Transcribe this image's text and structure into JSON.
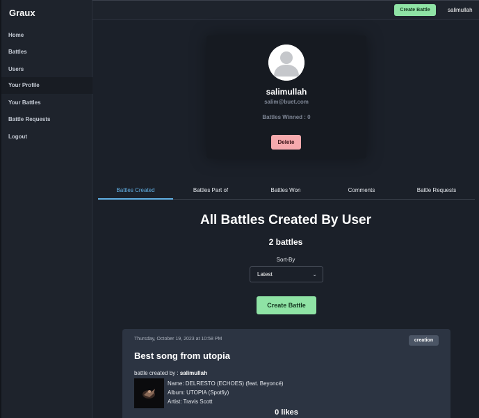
{
  "app": {
    "brand": "Graux"
  },
  "sidebar": {
    "items": [
      {
        "label": "Home"
      },
      {
        "label": "Battles"
      },
      {
        "label": "Users"
      },
      {
        "label": "Your Profile",
        "active": true
      },
      {
        "label": "Your Battles"
      },
      {
        "label": "Battle Requests"
      },
      {
        "label": "Logout"
      }
    ]
  },
  "topbar": {
    "create_label": "Create Battle",
    "username": "salimullah"
  },
  "profile": {
    "name": "salimullah",
    "email": "salim@buet.com",
    "wins": "Battles Winned : 0",
    "delete_label": "Delete"
  },
  "tabs": [
    {
      "label": "Battles Created",
      "active": true
    },
    {
      "label": "Battles Part of"
    },
    {
      "label": "Battles Won"
    },
    {
      "label": "Comments"
    },
    {
      "label": "Battle Requests"
    }
  ],
  "main": {
    "title": "All Battles Created By User",
    "count": "2 battles",
    "sort_label": "Sort-By",
    "sort_value": "Latest",
    "create_label": "Create Battle"
  },
  "battles": [
    {
      "date": "Thursday, October 19, 2023 at 10:58 PM",
      "badge": "creation",
      "title": "Best song from utopia",
      "created_by_prefix": "battle created by : ",
      "created_by": "salimullah",
      "song_name": "Name: DELRESTO (ECHOES) (feat. Beyoncé)",
      "album": "Album: UTOPIA (Spotfiy)",
      "artist": "Artist: Travis Scott",
      "likes": "0 likes"
    }
  ],
  "colors": {
    "accent_green": "#8fe3a5",
    "accent_blue": "#62b1e6",
    "danger": "#f5a9ad",
    "background": "#1b2029",
    "card": "#2c3442"
  }
}
